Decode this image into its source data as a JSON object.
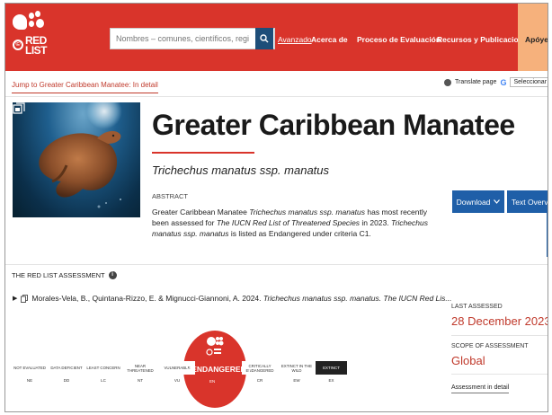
{
  "nav": {
    "search_placeholder": "Nombres – comunes, científicos, regiones, etc",
    "advanced_label": "Avanzado",
    "items": [
      "Acerca de",
      "Proceso de Evaluación",
      "Recursos y Publicaciones"
    ],
    "support_label": "Apóyenos",
    "logo_text_1": "RED",
    "logo_text_2": "LIST"
  },
  "jump_link": "Jump to Greater Caribbean Manatee: In detail",
  "translate": {
    "translate_label": "Translate page",
    "language_label": "Seleccionar idioma"
  },
  "species": {
    "title": "Greater Caribbean Manatee",
    "scientific_name": "Trichechus manatus ssp. manatus"
  },
  "abstract": {
    "heading": "ABSTRACT",
    "p1": "Greater Caribbean Manatee ",
    "p1_italic": "Trichechus manatus ssp. manatus",
    "p2": " has most recently been assessed for ",
    "p2_italic": "The IUCN Red List of Threatened Species",
    "p3": " in 2023. ",
    "p3_italic": "Trichechus manatus ssp. manatus",
    "p4": " is listed as Endangered under criteria C1."
  },
  "buttons": {
    "download": "Download",
    "text_overview": "Text Overview"
  },
  "assessment": {
    "heading": "THE RED LIST ASSESSMENT",
    "citation_plain": "Morales-Vela, B., Quintana-Rizzo, E. & Mignucci-Giannoni, A. 2024. ",
    "citation_italic": "Trichechus manatus ssp. manatus. The IUCN Red Lis...",
    "last_assessed_label": "LAST ASSESSED",
    "last_assessed_value": "28 December 2023",
    "scope_label": "SCOPE OF ASSESSMENT",
    "scope_value": "Global",
    "detail_link": "Assessment in detail"
  },
  "categories": [
    {
      "label": "NOT EVALUATED",
      "abbr": "NE"
    },
    {
      "label": "DATA DEFICIENT",
      "abbr": "DD"
    },
    {
      "label": "LEAST CONCERN",
      "abbr": "LC"
    },
    {
      "label": "NEAR THREATENED",
      "abbr": "NT"
    },
    {
      "label": "VULNERABLE",
      "abbr": "VU"
    },
    {
      "label": "‹ ENDANGERED ›",
      "abbr": "EN"
    },
    {
      "label": "CRITICALLY ENDANGERED",
      "abbr": "CR"
    },
    {
      "label": "EXTINCT IN THE WILD",
      "abbr": "EW"
    },
    {
      "label": "EXTINCT",
      "abbr": "EX"
    }
  ],
  "colors": {
    "brand_red": "#d9342b",
    "link_blue": "#1f5fa8",
    "support_orange": "#f6b17c"
  }
}
